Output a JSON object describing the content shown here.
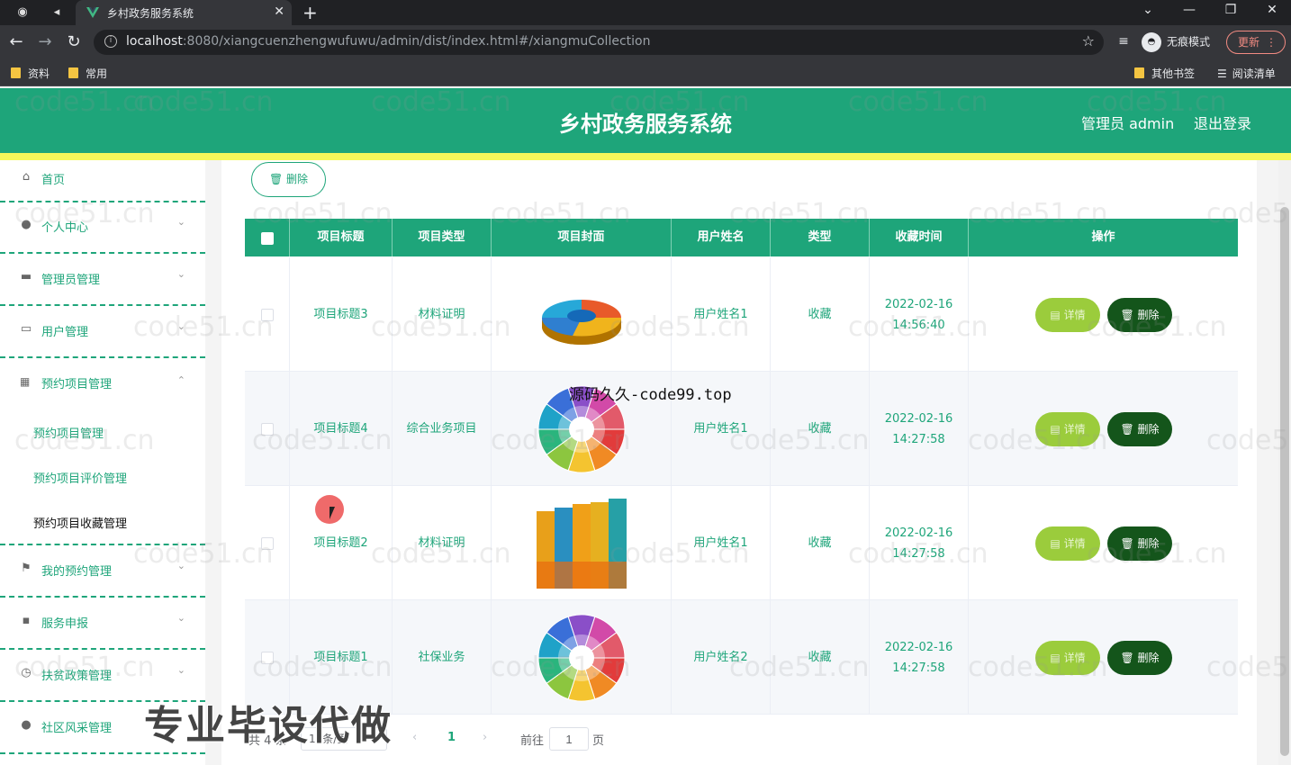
{
  "browser": {
    "tab_title": "乡村政务服务系统",
    "url_host": "localhost",
    "url_rest": ":8080/xiangcuenzhengwufuwu/admin/dist/index.html#/xiangmuCollection",
    "incognito_label": "无痕模式",
    "update_label": "更新",
    "bookmarks": [
      "资料",
      "常用"
    ],
    "other_bookmarks": "其他书签",
    "reading_list": "阅读清单"
  },
  "header": {
    "title": "乡村政务服务系统",
    "user": "管理员 admin",
    "logout": "退出登录"
  },
  "sidebar": {
    "items": [
      {
        "label": "首页",
        "icon": "home-icon"
      },
      {
        "label": "个人中心",
        "icon": "person-icon"
      },
      {
        "label": "管理员管理",
        "icon": "briefcase-icon"
      },
      {
        "label": "用户管理",
        "icon": "chat-icon"
      },
      {
        "label": "预约项目管理",
        "icon": "grid-icon"
      },
      {
        "label": "我的预约管理",
        "icon": "flag-icon"
      },
      {
        "label": "服务申报",
        "icon": "message-icon"
      },
      {
        "label": "扶贫政策管理",
        "icon": "clock-icon"
      },
      {
        "label": "社区风采管理",
        "icon": "person-icon"
      }
    ],
    "sub_items": [
      "预约项目管理",
      "预约项目评价管理",
      "预约项目收藏管理"
    ]
  },
  "toolbar": {
    "delete_label": "删除"
  },
  "table": {
    "columns": [
      "项目标题",
      "项目类型",
      "项目封面",
      "用户姓名",
      "类型",
      "收藏时间",
      "操作"
    ],
    "rows": [
      {
        "title": "项目标题3",
        "type": "材料证明",
        "cover": "pie-3d",
        "user": "用户姓名1",
        "kind": "收藏",
        "date": "2022-02-16",
        "time": "14:56:40"
      },
      {
        "title": "项目标题4",
        "type": "综合业务项目",
        "cover": "wheel",
        "user": "用户姓名1",
        "kind": "收藏",
        "date": "2022-02-16",
        "time": "14:27:58"
      },
      {
        "title": "项目标题2",
        "type": "材料证明",
        "cover": "bars",
        "user": "用户姓名1",
        "kind": "收藏",
        "date": "2022-02-16",
        "time": "14:27:58"
      },
      {
        "title": "项目标题1",
        "type": "社保业务",
        "cover": "wheel",
        "user": "用户姓名2",
        "kind": "收藏",
        "date": "2022-02-16",
        "time": "14:27:58"
      }
    ],
    "detail_label": "详情",
    "delete_label": "删除"
  },
  "pager": {
    "total": "共 4 条",
    "page_size": "10条/页",
    "current": "1",
    "goto_prefix": "前往",
    "goto_value": "1",
    "goto_suffix": "页"
  },
  "overlay": {
    "source_text": "源码久久-code99.top",
    "promo_text": "专业毕设代做",
    "watermark": "code51.cn"
  },
  "colors": {
    "primary": "#1ea57a",
    "accent_bar": "#f5f75a",
    "detail_btn": "#9bcc3c",
    "delete_btn": "#14551b"
  }
}
